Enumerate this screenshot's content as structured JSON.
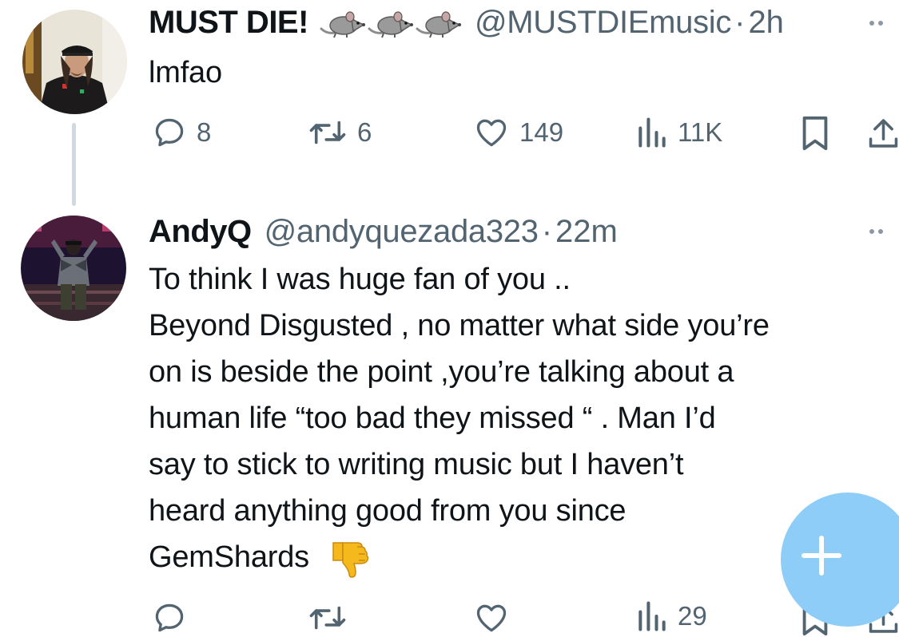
{
  "tweets": [
    {
      "author_name": "MUST DIE!",
      "name_emoji": [
        "rat-emoji",
        "rat-emoji",
        "rat-emoji"
      ],
      "handle": "@MUSTDIEmusic",
      "separator": "·",
      "time": "2h",
      "text_lines": [
        "lmfao"
      ],
      "stats": {
        "replies": "8",
        "retweets": "6",
        "likes": "149",
        "views": "11K"
      }
    },
    {
      "author_name": "AndyQ",
      "handle": "@andyquezada323",
      "separator": "·",
      "time": "22m",
      "text_lines": [
        "To think I was huge fan of you ..",
        "Beyond Disgusted , no matter what side you’re",
        "on is beside the point ,you’re talking about a",
        "human life “too bad they missed “ .  Man I’d",
        "say to stick to writing music but I haven’t",
        "heard anything good from you since",
        "GemShards"
      ],
      "trailing_emoji": "thumbs-down-emoji",
      "stats": {
        "replies": "",
        "retweets": "",
        "likes": "",
        "views": "29"
      }
    }
  ],
  "colors": {
    "text_primary": "#0f1419",
    "text_secondary": "#536471",
    "thread_line": "#cfd9de",
    "fab_background": "#8ecdf8",
    "thumbs_down": "#f5b91d"
  },
  "fab": {
    "icon": "plus-icon"
  }
}
